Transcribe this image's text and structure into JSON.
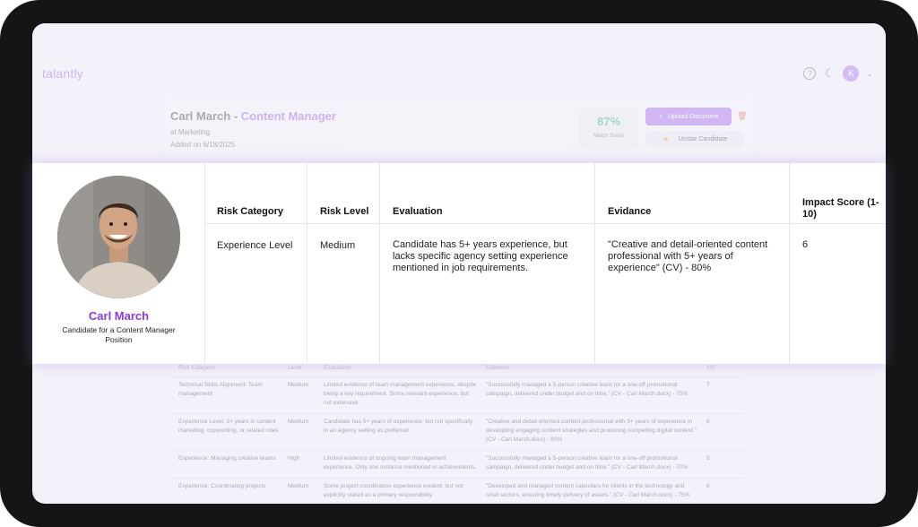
{
  "app": {
    "logo": "talantly",
    "help_icon": "?",
    "avatar_initial": "K"
  },
  "candidate": {
    "name": "Carl March",
    "name_sep": " - ",
    "role": "Content Manager",
    "department": "at Marketing",
    "added": "Added on 6/18/2025",
    "match_score": "87%",
    "match_label": "Match Score",
    "upload_label": "Upload Document",
    "unstar_label": "Unstar Candidate"
  },
  "overlay": {
    "profile_name": "Carl March",
    "profile_role": "Candidate for a Content Manager Position",
    "columns": [
      "Risk Category",
      "Risk Level",
      "Evaluation",
      "Evidance",
      "Impact Score (1-10)"
    ],
    "row": {
      "category": "Experience Level",
      "level": "Medium",
      "evaluation": "Candidate has 5+ years experience, but lacks specific agency setting experience mentioned in job requirements.",
      "evidence": "\"Creative and detail-oriented content professional with 5+ years of experience\" (CV) - 80%",
      "score": "6"
    }
  },
  "bg_table": {
    "headers": [
      "Risk Category",
      "Level",
      "Evaluation",
      "Evidence",
      "10)"
    ],
    "rows": [
      {
        "category": "Technical Skills Alignment: Team management",
        "level": "Medium",
        "evaluation": "Limited evidence of team management experience, despite being a key requirement. Some relevant experience, but not extensive.",
        "evidence": "\"Successfully managed a 5-person creative team for a one-off promotional campaign, delivered under budget and on time.\" (CV - Carl March.docx) - 75%",
        "score": "7"
      },
      {
        "category": "Experience Level: 3+ years in content marketing, copywriting, or related roles",
        "level": "Medium",
        "evaluation": "Candidate has 5+ years of experience, but not specifically in an agency setting as preferred.",
        "evidence": "\"Creative and detail-oriented content professional with 5+ years of experience in developing engaging content strategies and producing compelling digital content.\" (CV - Carl March.docx) - 80%",
        "score": "6"
      },
      {
        "category": "Experience: Managing creative teams",
        "level": "High",
        "evaluation": "Limited evidence of ongoing team management experience. Only one instance mentioned in achievements.",
        "evidence": "\"Successfully managed a 5-person creative team for a one-off promotional campaign, delivered under budget and on time.\" (CV - Carl March.docx) - 70%",
        "score": "8"
      },
      {
        "category": "Experience: Coordinating projects",
        "level": "Medium",
        "evaluation": "Some project coordination experience evident, but not explicitly stated as a primary responsibility.",
        "evidence": "\"Developed and managed content calendars for clients in the technology and retail sectors, ensuring timely delivery of assets.\" (CV - Carl March.docx) - 75%",
        "score": "6"
      }
    ]
  },
  "colors": {
    "accent": "#a06ae8",
    "name_purple": "#8a3be0",
    "match_green": "#3fb89a",
    "danger": "#e05a5a"
  }
}
